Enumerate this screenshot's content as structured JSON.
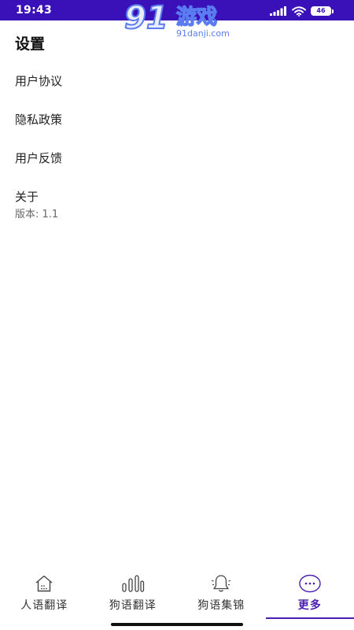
{
  "status_bar": {
    "time": "19:43",
    "battery": "46",
    "bg_color": "#3a10b8"
  },
  "watermark": {
    "logo": "91",
    "text": "游戏",
    "site": "91danji.com"
  },
  "page": {
    "title": "设置",
    "items": [
      {
        "label": "用户协议"
      },
      {
        "label": "隐私政策"
      },
      {
        "label": "用户反馈"
      },
      {
        "label": "关于",
        "sub": "版本: 1.1"
      }
    ]
  },
  "bottom_nav": {
    "accent_color": "#4a1fb0",
    "active_index": 3,
    "tabs": [
      {
        "label": "人语翻译",
        "icon": "house-icon"
      },
      {
        "label": "狗语翻译",
        "icon": "bars-icon"
      },
      {
        "label": "狗语集锦",
        "icon": "bell-icon"
      },
      {
        "label": "更多",
        "icon": "more-icon"
      }
    ]
  }
}
